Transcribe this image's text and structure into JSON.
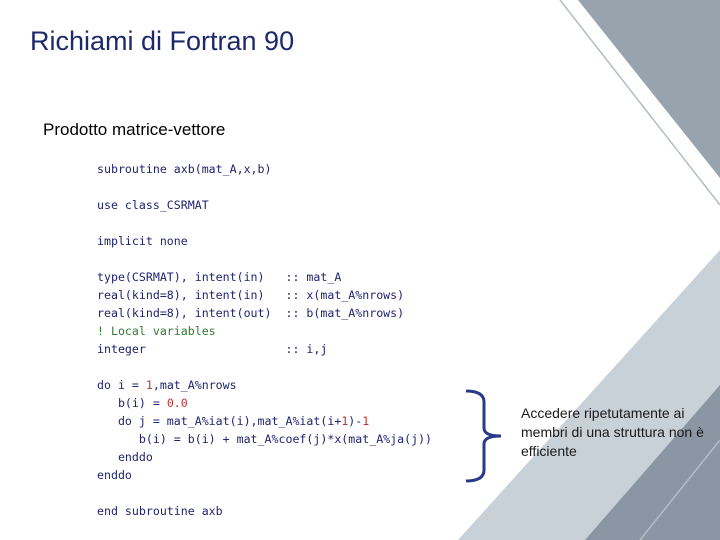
{
  "slide": {
    "title": "Richiami di Fortran 90",
    "subtitle": "Prodotto matrice-vettore",
    "note": "Accedere ripetutamente ai membri di una struttura non è efficiente"
  },
  "code": {
    "lines": [
      [
        {
          "t": "subroutine axb(mat_A,x,b)"
        }
      ],
      [
        {
          "t": ""
        }
      ],
      [
        {
          "t": "use class_CSRMAT"
        }
      ],
      [
        {
          "t": ""
        }
      ],
      [
        {
          "t": "implicit none"
        }
      ],
      [
        {
          "t": ""
        }
      ],
      [
        {
          "t": "type(CSRMAT), intent(in)   :: mat_A"
        }
      ],
      [
        {
          "t": "real(kind=8), intent(in)   :: x(mat_A%nrows)"
        }
      ],
      [
        {
          "t": "real(kind=8), intent(out)  :: b(mat_A%nrows)"
        }
      ],
      [
        {
          "t": "! Local variables",
          "c": "cmt"
        }
      ],
      [
        {
          "t": "integer                    :: i,j"
        }
      ],
      [
        {
          "t": ""
        }
      ],
      [
        {
          "t": "do i = "
        },
        {
          "t": "1",
          "c": "num"
        },
        {
          "t": ",mat_A%nrows"
        }
      ],
      [
        {
          "t": "   b(i) = "
        },
        {
          "t": "0.0",
          "c": "num"
        }
      ],
      [
        {
          "t": "   do j = mat_A%iat(i),mat_A%iat(i+"
        },
        {
          "t": "1",
          "c": "num"
        },
        {
          "t": ")-"
        },
        {
          "t": "1",
          "c": "num"
        }
      ],
      [
        {
          "t": "      b(i) = b(i) + mat_A%coef(j)*x(mat_A%ja(j))"
        }
      ],
      [
        {
          "t": "   enddo"
        }
      ],
      [
        {
          "t": "enddo"
        }
      ],
      [
        {
          "t": ""
        }
      ],
      [
        {
          "t": "end subroutine axb"
        }
      ]
    ]
  },
  "colors": {
    "title": "#1c2a6b",
    "code_text": "#1f2470",
    "code_number": "#c2342f",
    "code_comment": "#2f7b2f",
    "brace": "#2a3a8a",
    "decor_light": "#c3ccd5",
    "decor_dark": "#7f8c99"
  }
}
